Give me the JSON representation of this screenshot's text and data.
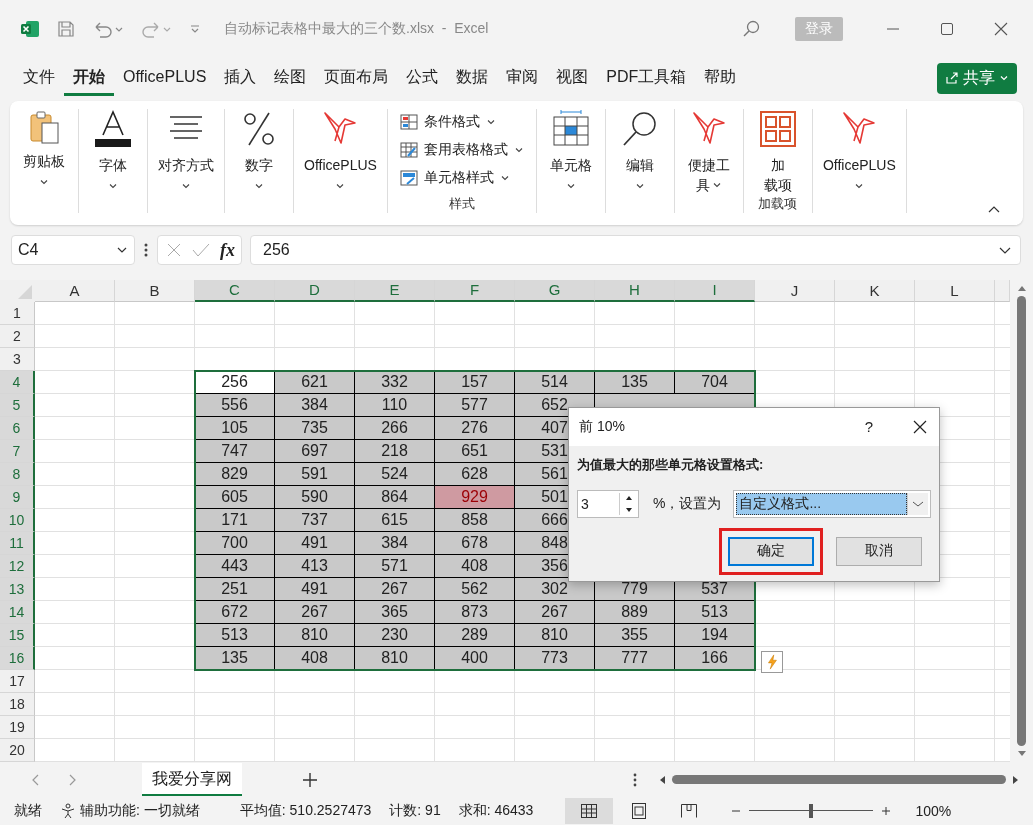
{
  "window": {
    "title": "自动标记表格中最大的三个数.xlsx  -  Excel",
    "sign_in": "登录"
  },
  "menu": {
    "tabs": [
      {
        "label": "文件",
        "selected": false
      },
      {
        "label": "开始",
        "selected": true
      },
      {
        "label": "OfficePLUS",
        "selected": false
      },
      {
        "label": "插入",
        "selected": false
      },
      {
        "label": "绘图",
        "selected": false
      },
      {
        "label": "页面布局",
        "selected": false
      },
      {
        "label": "公式",
        "selected": false
      },
      {
        "label": "数据",
        "selected": false
      },
      {
        "label": "审阅",
        "selected": false
      },
      {
        "label": "视图",
        "selected": false
      },
      {
        "label": "PDF工具箱",
        "selected": false
      },
      {
        "label": "帮助",
        "selected": false
      }
    ],
    "share": "共享"
  },
  "ribbon": {
    "groups": [
      {
        "items": [
          {
            "kind": "big",
            "lines": [
              "剪贴板"
            ],
            "caret": true
          }
        ]
      },
      {
        "items": [
          {
            "kind": "big",
            "lines": [
              "字体"
            ],
            "caret": true
          }
        ]
      },
      {
        "items": [
          {
            "kind": "big",
            "lines": [
              "对齐方式"
            ],
            "caret": true
          }
        ]
      },
      {
        "items": [
          {
            "kind": "big",
            "lines": [
              "数字"
            ],
            "caret": true
          }
        ]
      },
      {
        "items": [
          {
            "kind": "big",
            "lines": [
              "OfficePLUS"
            ],
            "caret": true
          }
        ]
      },
      {
        "label": "样式",
        "items": [
          {
            "kind": "small",
            "lines": [
              "条件格式"
            ],
            "caret": true
          },
          {
            "kind": "small",
            "lines": [
              "套用表格格式"
            ],
            "caret": true
          },
          {
            "kind": "small",
            "lines": [
              "单元格样式"
            ],
            "caret": true
          }
        ]
      },
      {
        "items": [
          {
            "kind": "big",
            "lines": [
              "单元格"
            ],
            "caret": true
          }
        ]
      },
      {
        "items": [
          {
            "kind": "big",
            "lines": [
              "编辑"
            ],
            "caret": true
          }
        ]
      },
      {
        "items": [
          {
            "kind": "big",
            "lines": [
              "便捷工",
              "具"
            ],
            "caret": true
          }
        ]
      },
      {
        "label": "加载项",
        "items": [
          {
            "kind": "big",
            "lines": [
              "加",
              "载项"
            ],
            "caret": false
          }
        ]
      },
      {
        "items": [
          {
            "kind": "big",
            "lines": [
              "OfficePLUS"
            ],
            "caret": true
          }
        ]
      }
    ]
  },
  "formula_bar": {
    "name_box": "C4",
    "function_label": "fx",
    "value": "256"
  },
  "sheet": {
    "columns": [
      {
        "label": "A",
        "selected": false
      },
      {
        "label": "B",
        "selected": false
      },
      {
        "label": "C",
        "selected": true
      },
      {
        "label": "D",
        "selected": true
      },
      {
        "label": "E",
        "selected": true
      },
      {
        "label": "F",
        "selected": true
      },
      {
        "label": "G",
        "selected": true
      },
      {
        "label": "H",
        "selected": true
      },
      {
        "label": "I",
        "selected": true
      },
      {
        "label": "J",
        "selected": false
      },
      {
        "label": "K",
        "selected": false
      },
      {
        "label": "L",
        "selected": false
      }
    ],
    "rows": [
      {
        "label": "1",
        "selected": false
      },
      {
        "label": "2",
        "selected": false
      },
      {
        "label": "3",
        "selected": false
      },
      {
        "label": "4",
        "selected": true,
        "cells": [
          {
            "value": "256",
            "active": true,
            "highlighted": false
          },
          {
            "value": "621",
            "active": false,
            "highlighted": false
          },
          {
            "value": "332",
            "active": false,
            "highlighted": false
          },
          {
            "value": "157",
            "active": false,
            "highlighted": false
          },
          {
            "value": "514",
            "active": false,
            "highlighted": false
          },
          {
            "value": "135",
            "active": false,
            "highlighted": false
          },
          {
            "value": "704",
            "active": false,
            "highlighted": false
          }
        ]
      },
      {
        "label": "5",
        "selected": true,
        "cells": [
          {
            "value": "556",
            "active": false,
            "highlighted": false
          },
          {
            "value": "384",
            "active": false,
            "highlighted": false
          },
          {
            "value": "110",
            "active": false,
            "highlighted": false
          },
          {
            "value": "577",
            "active": false,
            "highlighted": false
          },
          {
            "value": "652",
            "active": false,
            "highlighted": false
          }
        ]
      },
      {
        "label": "6",
        "selected": true,
        "cells": [
          {
            "value": "105",
            "active": false,
            "highlighted": false
          },
          {
            "value": "735",
            "active": false,
            "highlighted": false
          },
          {
            "value": "266",
            "active": false,
            "highlighted": false
          },
          {
            "value": "276",
            "active": false,
            "highlighted": false
          },
          {
            "value": "407",
            "active": false,
            "highlighted": false
          }
        ]
      },
      {
        "label": "7",
        "selected": true,
        "cells": [
          {
            "value": "747",
            "active": false,
            "highlighted": false
          },
          {
            "value": "697",
            "active": false,
            "highlighted": false
          },
          {
            "value": "218",
            "active": false,
            "highlighted": false
          },
          {
            "value": "651",
            "active": false,
            "highlighted": false
          },
          {
            "value": "531",
            "active": false,
            "highlighted": false
          }
        ]
      },
      {
        "label": "8",
        "selected": true,
        "cells": [
          {
            "value": "829",
            "active": false,
            "highlighted": false
          },
          {
            "value": "591",
            "active": false,
            "highlighted": false
          },
          {
            "value": "524",
            "active": false,
            "highlighted": false
          },
          {
            "value": "628",
            "active": false,
            "highlighted": false
          },
          {
            "value": "561",
            "active": false,
            "highlighted": false
          }
        ]
      },
      {
        "label": "9",
        "selected": true,
        "cells": [
          {
            "value": "605",
            "active": false,
            "highlighted": false
          },
          {
            "value": "590",
            "active": false,
            "highlighted": false
          },
          {
            "value": "864",
            "active": false,
            "highlighted": false
          },
          {
            "value": "929",
            "active": false,
            "highlighted": true
          },
          {
            "value": "501",
            "active": false,
            "highlighted": false
          }
        ]
      },
      {
        "label": "10",
        "selected": true,
        "cells": [
          {
            "value": "171",
            "active": false,
            "highlighted": false
          },
          {
            "value": "737",
            "active": false,
            "highlighted": false
          },
          {
            "value": "615",
            "active": false,
            "highlighted": false
          },
          {
            "value": "858",
            "active": false,
            "highlighted": false
          },
          {
            "value": "666",
            "active": false,
            "highlighted": false
          }
        ]
      },
      {
        "label": "11",
        "selected": true,
        "cells": [
          {
            "value": "700",
            "active": false,
            "highlighted": false
          },
          {
            "value": "491",
            "active": false,
            "highlighted": false
          },
          {
            "value": "384",
            "active": false,
            "highlighted": false
          },
          {
            "value": "678",
            "active": false,
            "highlighted": false
          },
          {
            "value": "848",
            "active": false,
            "highlighted": false
          }
        ]
      },
      {
        "label": "12",
        "selected": true,
        "cells": [
          {
            "value": "443",
            "active": false,
            "highlighted": false
          },
          {
            "value": "413",
            "active": false,
            "highlighted": false
          },
          {
            "value": "571",
            "active": false,
            "highlighted": false
          },
          {
            "value": "408",
            "active": false,
            "highlighted": false
          },
          {
            "value": "356",
            "active": false,
            "highlighted": false
          }
        ]
      },
      {
        "label": "13",
        "selected": true,
        "cells": [
          {
            "value": "251",
            "active": false,
            "highlighted": false
          },
          {
            "value": "491",
            "active": false,
            "highlighted": false
          },
          {
            "value": "267",
            "active": false,
            "highlighted": false
          },
          {
            "value": "562",
            "active": false,
            "highlighted": false
          },
          {
            "value": "302",
            "active": false,
            "highlighted": false
          },
          {
            "value": "779",
            "active": false,
            "highlighted": false
          },
          {
            "value": "537",
            "active": false,
            "highlighted": false
          }
        ]
      },
      {
        "label": "14",
        "selected": true,
        "cells": [
          {
            "value": "672",
            "active": false,
            "highlighted": false
          },
          {
            "value": "267",
            "active": false,
            "highlighted": false
          },
          {
            "value": "365",
            "active": false,
            "highlighted": false
          },
          {
            "value": "873",
            "active": false,
            "highlighted": false
          },
          {
            "value": "267",
            "active": false,
            "highlighted": false
          },
          {
            "value": "889",
            "active": false,
            "highlighted": false
          },
          {
            "value": "513",
            "active": false,
            "highlighted": false
          }
        ]
      },
      {
        "label": "15",
        "selected": true,
        "cells": [
          {
            "value": "513",
            "active": false,
            "highlighted": false
          },
          {
            "value": "810",
            "active": false,
            "highlighted": false
          },
          {
            "value": "230",
            "active": false,
            "highlighted": false
          },
          {
            "value": "289",
            "active": false,
            "highlighted": false
          },
          {
            "value": "810",
            "active": false,
            "highlighted": false
          },
          {
            "value": "355",
            "active": false,
            "highlighted": false
          },
          {
            "value": "194",
            "active": false,
            "highlighted": false
          }
        ]
      },
      {
        "label": "16",
        "selected": true,
        "cells": [
          {
            "value": "135",
            "active": false,
            "highlighted": false
          },
          {
            "value": "408",
            "active": false,
            "highlighted": false
          },
          {
            "value": "810",
            "active": false,
            "highlighted": false
          },
          {
            "value": "400",
            "active": false,
            "highlighted": false
          },
          {
            "value": "773",
            "active": false,
            "highlighted": false
          },
          {
            "value": "777",
            "active": false,
            "highlighted": false
          },
          {
            "value": "166",
            "active": false,
            "highlighted": false
          }
        ]
      },
      {
        "label": "17",
        "selected": false
      },
      {
        "label": "18",
        "selected": false
      },
      {
        "label": "19",
        "selected": false
      },
      {
        "label": "20",
        "selected": false
      }
    ]
  },
  "dialog": {
    "title": "前 10%",
    "help": "?",
    "prompt": "为值最大的那些单元格设置格式:",
    "spinner_value": "3",
    "middle_label": "%，设置为",
    "format_select": "自定义格式...",
    "buttons": [
      {
        "label": "确定",
        "highlighted": true
      },
      {
        "label": "取消",
        "highlighted": false
      }
    ]
  },
  "sheet_tabs": [
    {
      "label": "我爱分享网",
      "selected": true
    }
  ],
  "status_bar": {
    "ready": "就绪",
    "accessibility": "辅助功能: 一切就绪",
    "average": "平均值: 510.2527473",
    "count": "计数: 91",
    "sum": "求和: 46433",
    "views": [
      {
        "kind": "normal",
        "selected": true
      },
      {
        "kind": "page",
        "selected": false
      },
      {
        "kind": "break",
        "selected": false
      }
    ],
    "zoom": {
      "level": 0.5,
      "reading": "100%"
    }
  }
}
